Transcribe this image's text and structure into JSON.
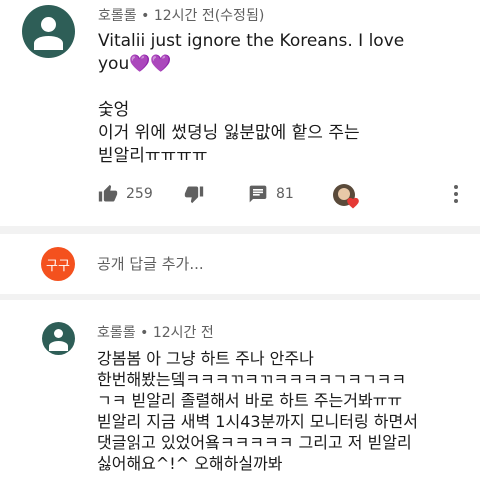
{
  "comment": {
    "author": "호롤롤",
    "time": "12시간 전(수정됨)",
    "text": "Vitalii just ignore the Koreans. I love\nyou💜💜\n\n숯엉\n이거 위에 썼뎡닝 잃분맚에 핱으 주는\n빋알리ㅠㅠㅠㅠ",
    "likes": "259",
    "replies": "81"
  },
  "reply_box": {
    "avatar_text": "구구",
    "placeholder": "공개 답글 추가..."
  },
  "reply": {
    "author": "호롤롤",
    "time": "12시간 전",
    "text": "강봄봄 아 그냥 하트 주나 안주나\n한번해봤는뎈ㅋㅋㅋㄲㅋㄲㅋㅋㅋㅋㄱㅋㄱㅋㅋ\nㄱㅋ 빋알리 졸렬해서 바로 하트 주는거봐ㅠㅠ\n빋알리 지금 새벽 1시43분까지 모니터링 하면서\n댓글읽고 있었어욬ㅋㅋㅋㅋㅋ 그리고 저 빋알리\n싫어해요^!^ 오해하실까봐"
  },
  "colors": {
    "avatar": "#2e5e57",
    "reply_avatar": "#f4511e",
    "heart": "#e53935",
    "icon": "#606060"
  }
}
